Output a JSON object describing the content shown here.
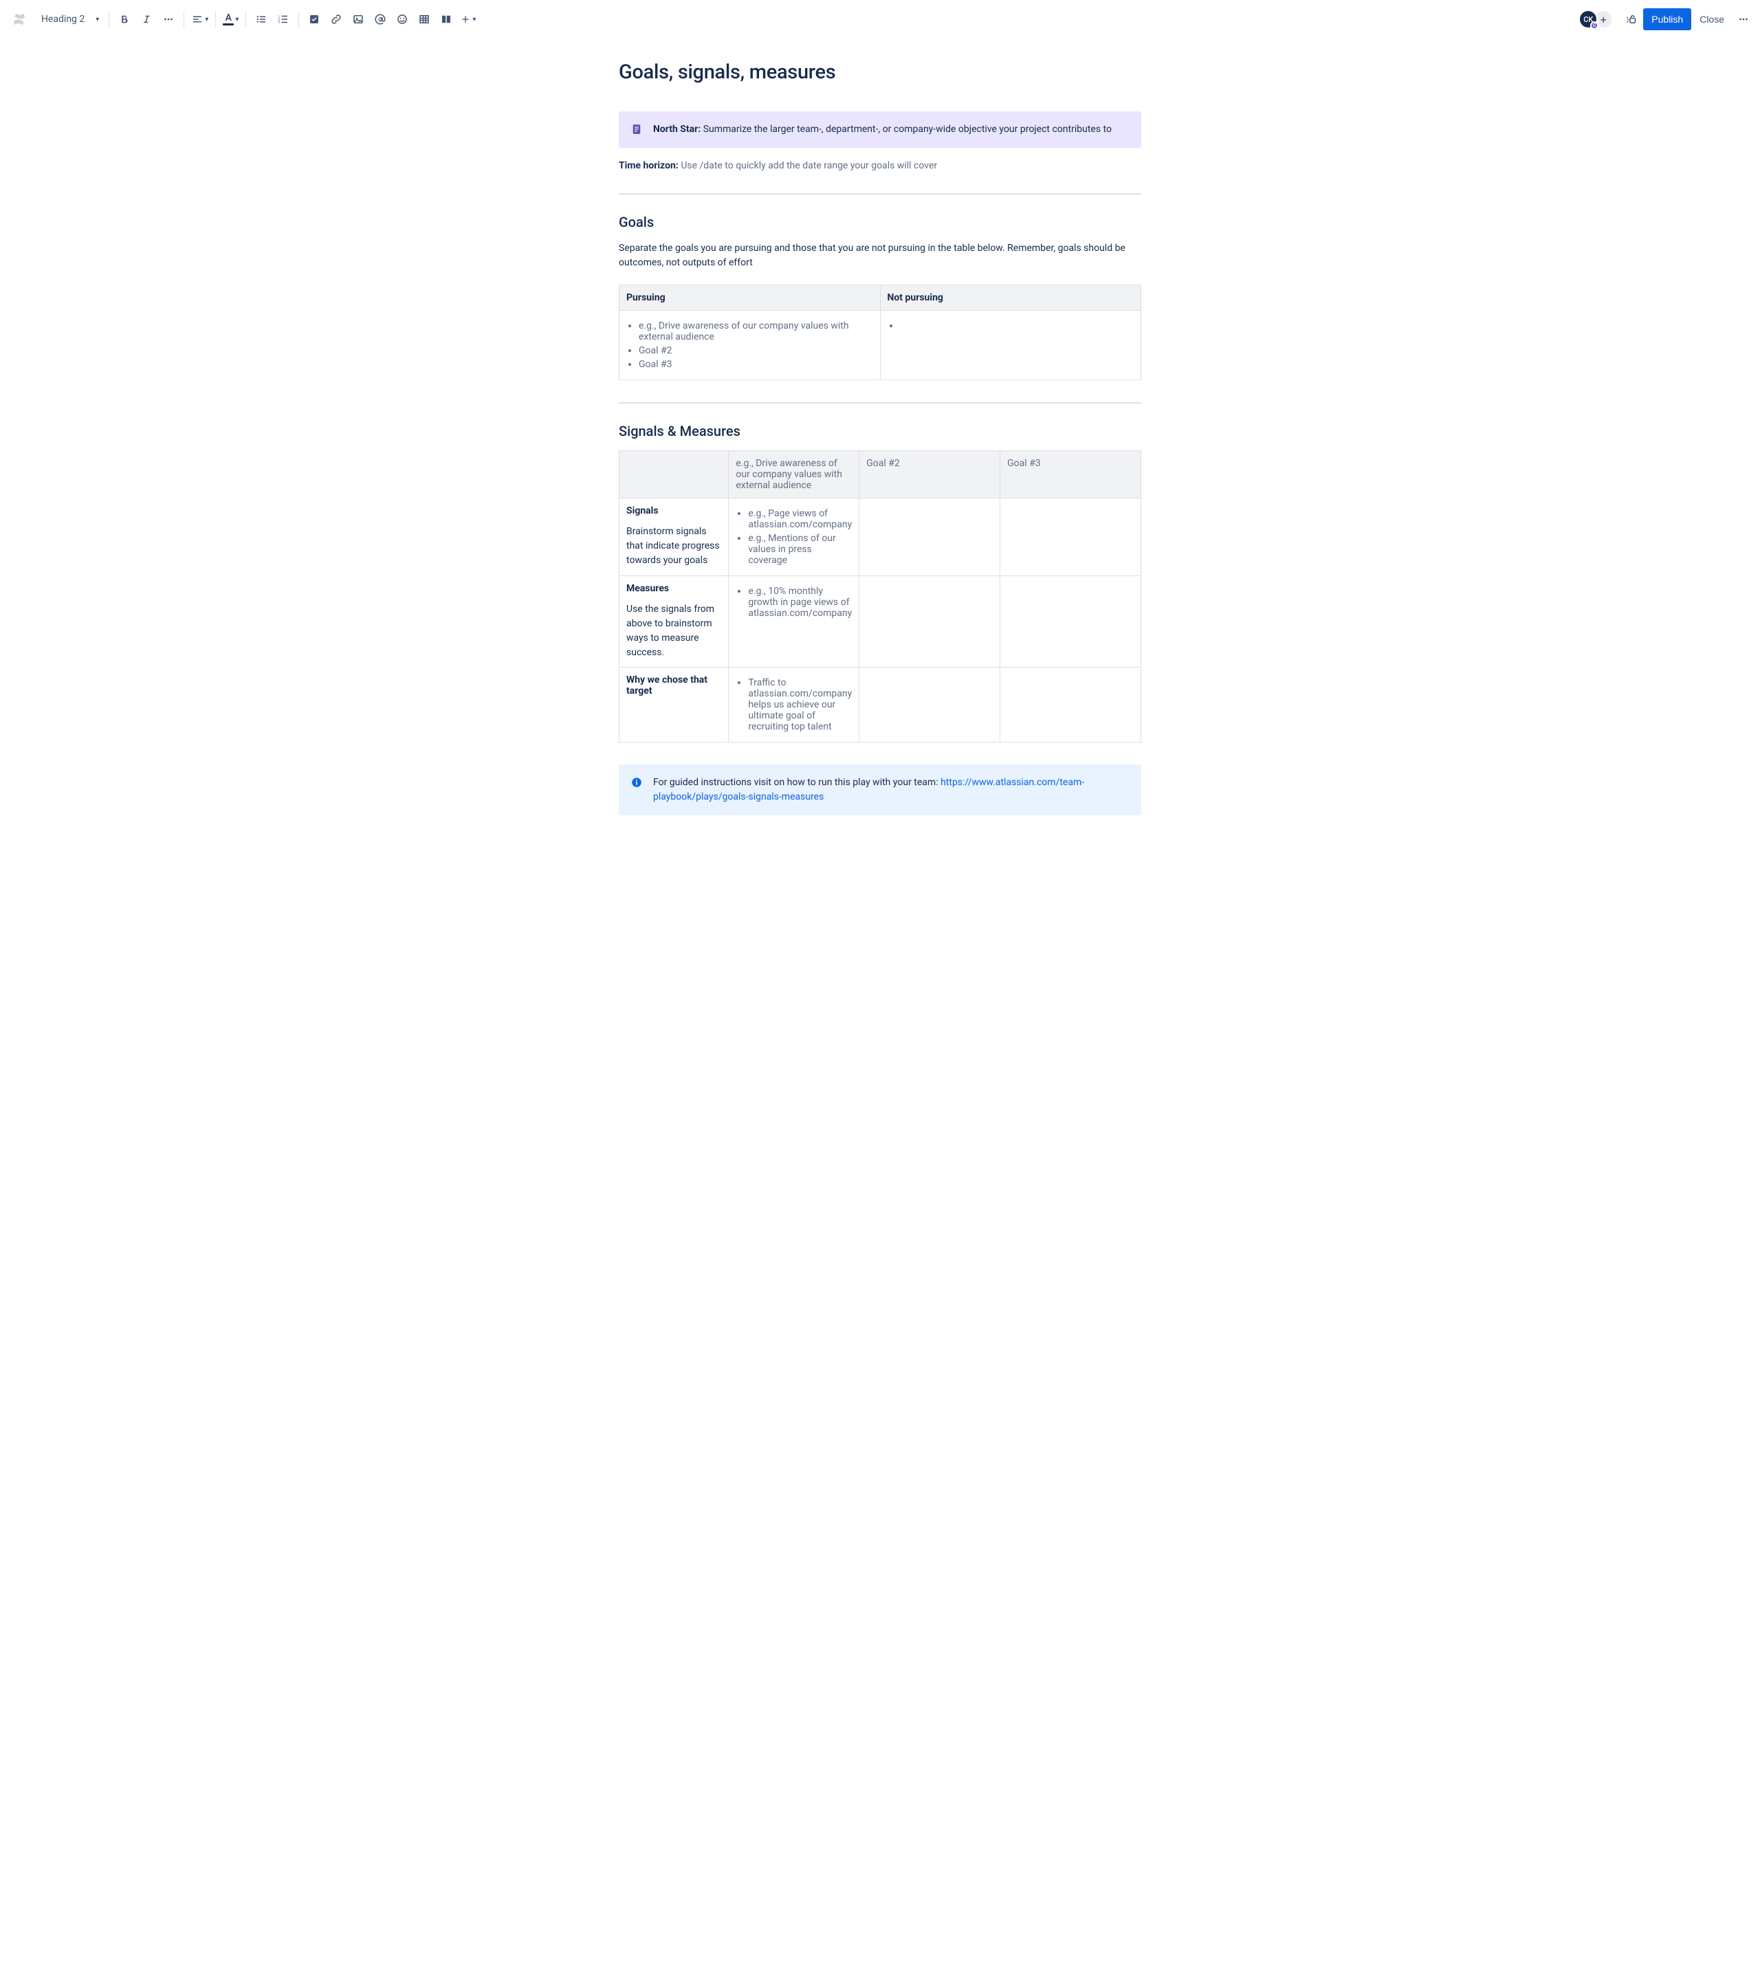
{
  "toolbar": {
    "heading_dropdown": "Heading 2",
    "publish_label": "Publish",
    "close_label": "Close",
    "avatar_initials": "CK",
    "avatar_status_letter": "C"
  },
  "page": {
    "title": "Goals, signals, measures",
    "north_star_label": "North Star:",
    "north_star_text": "Summarize the larger team-, department-, or company-wide objective your project contributes to",
    "time_horizon_label": "Time horizon:",
    "time_horizon_text": "Use /date to quickly add the date range your goals will cover",
    "goals_heading": "Goals",
    "goals_intro": "Separate the goals you are pursuing and those that you are not pursuing in the table below. Remember, goals should be outcomes, not outputs of effort",
    "goals_table": {
      "pursuing_header": "Pursuing",
      "not_pursuing_header": "Not pursuing",
      "pursuing_items": [
        "e.g., Drive awareness of our company values with external audience",
        "Goal #2",
        "Goal #3"
      ],
      "not_pursuing_items": [
        ""
      ]
    },
    "signals_heading": "Signals & Measures",
    "signals_table": {
      "col_headers": [
        "",
        "e.g., Drive awareness of our company values with external audience",
        "Goal #2",
        "Goal #3"
      ],
      "rows": [
        {
          "label": "Signals",
          "desc": "Brainstorm signals that indicate progress towards your goals",
          "col1_items": [
            "e.g., Page views of atlassian.com/company",
            "e.g., Mentions of our values in press coverage"
          ]
        },
        {
          "label": "Measures",
          "desc": "Use the signals from above to brainstorm ways to measure success.",
          "col1_items": [
            "e.g., 10% monthly growth in page views of atlassian.com/company"
          ]
        },
        {
          "label": "Why we chose that target",
          "desc": "",
          "col1_items": [
            "Traffic to atlassian.com/company helps us achieve our ultimate goal of recruiting top talent"
          ]
        }
      ]
    },
    "info_panel_text": "For guided instructions visit on how to run this play with your team: ",
    "info_panel_link": "https://www.atlassian.com/team-playbook/plays/goals-signals-measures"
  }
}
